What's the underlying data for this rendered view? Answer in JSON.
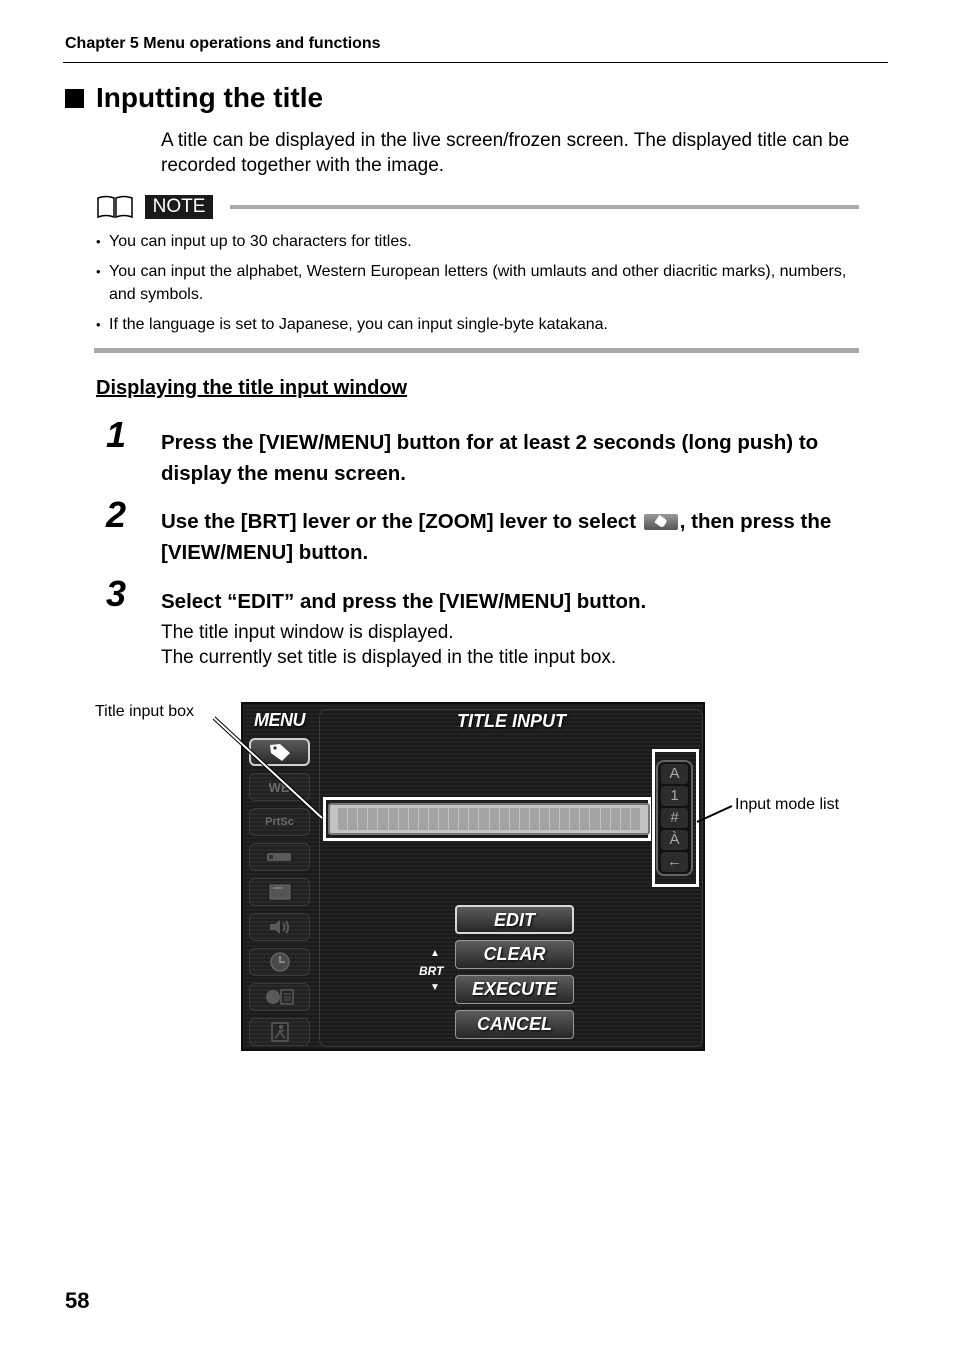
{
  "header": {
    "chapter": "Chapter 5 Menu operations and functions"
  },
  "section": {
    "title": "Inputting the title",
    "intro": "A title can be displayed in the live screen/frozen screen. The displayed title can be recorded together with the image."
  },
  "note": {
    "icon": "book-icon",
    "label": "NOTE",
    "items": [
      "You can input up to 30 characters for titles.",
      "You can input the alphabet, Western European letters (with umlauts and other diacritic marks), numbers, and symbols.",
      "If the language is set to Japanese, you can input single-byte katakana."
    ]
  },
  "subsection": {
    "title": "Displaying the title input window"
  },
  "steps": [
    {
      "number": "1",
      "text": "Press the [VIEW/MENU] button for at least 2 seconds (long push) to display the menu screen."
    },
    {
      "number": "2",
      "text_before": "Use the [BRT] lever or the [ZOOM] lever to select ",
      "icon": "tag-icon",
      "text_after": ", then press the [VIEW/MENU] button."
    },
    {
      "number": "3",
      "text": "Select “EDIT” and press the [VIEW/MENU] button.",
      "sub": [
        "The title input window is displayed.",
        "The currently set title is displayed in the title input box."
      ]
    }
  ],
  "screen": {
    "menu_label": "MENU",
    "panel_title": "TITLE INPUT",
    "side_menu": [
      {
        "icon": "tag-icon",
        "label": "",
        "active": true
      },
      {
        "icon": "wb-icon",
        "label": "WB"
      },
      {
        "icon": "prtsc-icon",
        "label": "PrtSc"
      },
      {
        "icon": "usb-drive-icon",
        "label": ""
      },
      {
        "icon": "display-icon",
        "label": ""
      },
      {
        "icon": "speaker-icon",
        "label": ""
      },
      {
        "icon": "clock-icon",
        "label": ""
      },
      {
        "icon": "language-icon",
        "label": ""
      },
      {
        "icon": "exit-icon",
        "label": ""
      }
    ],
    "title_input_cells": 30,
    "input_modes": [
      "A",
      "1",
      "#",
      "À",
      "←"
    ],
    "buttons": [
      "EDIT",
      "CLEAR",
      "EXECUTE",
      "CANCEL"
    ],
    "selected_button": "EDIT",
    "brt": {
      "label": "BRT",
      "up": "▲",
      "down": "▼"
    }
  },
  "callouts": {
    "left": "Title input box",
    "right": "Input mode list"
  },
  "page_number": "58"
}
